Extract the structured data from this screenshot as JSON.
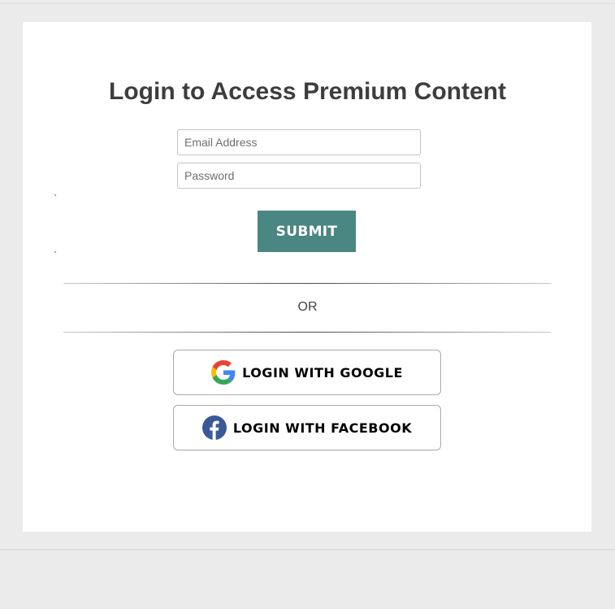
{
  "login": {
    "title": "Login to Access Premium Content",
    "email_placeholder": "Email Address",
    "password_placeholder": "Password",
    "tick_mark": "`",
    "submit_label": "SUBMIT",
    "or_label": "OR",
    "google_label": "LOGIN WITH GOOGLE",
    "facebook_label": "LOGIN WITH FACEBOOK"
  },
  "icons": {
    "google": "google-icon",
    "facebook": "facebook-icon"
  },
  "colors": {
    "submit_bg": "#4a8682",
    "facebook_blue": "#3b5998",
    "page_bg": "#ebebeb",
    "title_text": "#3d3d3d"
  }
}
